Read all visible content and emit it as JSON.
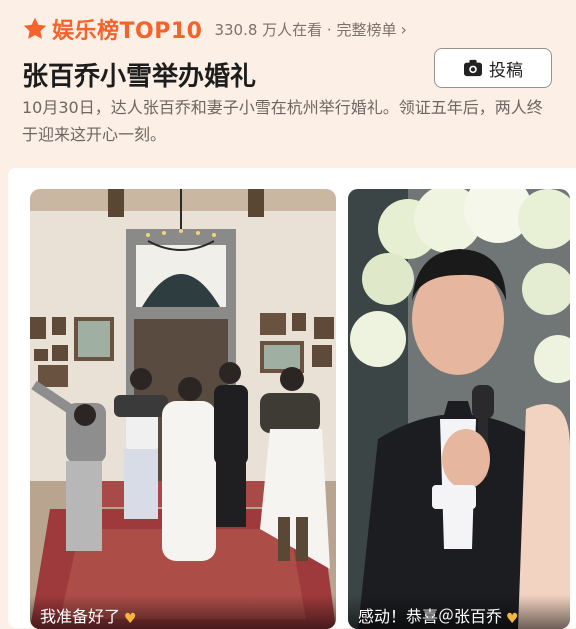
{
  "header": {
    "brand": "娱乐榜TOP10",
    "viewers": "330.8 万人在看 · 完整榜单",
    "accent": "#f4632c"
  },
  "headline": "张百乔小雪举办婚礼",
  "submit_label": "投稿",
  "description": "10月30日，达人张百乔和妻子小雪在杭州举行婚礼。领证五年后，两人终于迎来这开心一刻。",
  "cards": [
    {
      "caption": "我准备好了",
      "icon": "heart-hands-icon"
    },
    {
      "caption": "感动！恭喜＠张百乔",
      "icon": "heart-hands-icon"
    }
  ]
}
